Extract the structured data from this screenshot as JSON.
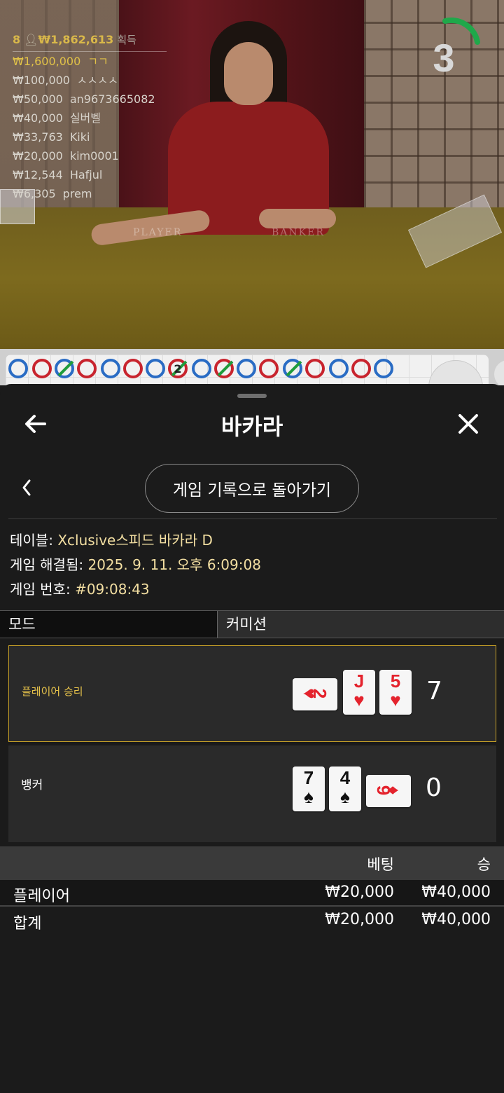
{
  "video": {
    "felt_labels": {
      "player": "PLAYER",
      "banker": "BANKER"
    },
    "countdown": "3",
    "winners": {
      "header_count": "8",
      "header_total": "₩1,862,613",
      "header_suffix": "획득",
      "rows": [
        {
          "amount": "₩1,600,000",
          "name": "ㄱㄱ"
        },
        {
          "amount": "₩100,000",
          "name": "ㅅㅅㅅㅅ"
        },
        {
          "amount": "₩50,000",
          "name": "an9673665082"
        },
        {
          "amount": "₩40,000",
          "name": "실버벨"
        },
        {
          "amount": "₩33,763",
          "name": "Kiki"
        },
        {
          "amount": "₩20,000",
          "name": "kim0001"
        },
        {
          "amount": "₩12,544",
          "name": "Hafjul"
        },
        {
          "amount": "₩6,305",
          "name": "prem"
        }
      ]
    },
    "road_marker_number": "2"
  },
  "panel": {
    "title": "바카라",
    "back_to_history": "게임 기록으로 돌아가기",
    "info": {
      "table_label": "테이블:",
      "table_value": "Xclusive스피드 바카라 D",
      "resolved_label": "게임 해결됨:",
      "resolved_value": "2025. 9. 11. 오후 6:09:08",
      "number_label": "게임 번호:",
      "number_value": "#09:08:43"
    },
    "tabs": [
      "모드",
      "커미션"
    ],
    "player_hand": {
      "label": "플레이어 승리",
      "score": "7",
      "cards": [
        {
          "rank": "2",
          "suit": "♥"
        },
        {
          "rank": "J",
          "suit": "♥"
        },
        {
          "rank": "5",
          "suit": "♥"
        }
      ]
    },
    "banker_hand": {
      "label": "뱅커",
      "score": "0",
      "cards": [
        {
          "rank": "7",
          "suit": "♠"
        },
        {
          "rank": "4",
          "suit": "♠"
        },
        {
          "rank": "9",
          "suit": "♦"
        }
      ]
    },
    "bets": {
      "col_bet": "베팅",
      "col_win": "승",
      "rows": [
        {
          "name": "플레이어",
          "bet": "₩20,000",
          "win": "₩40,000"
        },
        {
          "name": "합계",
          "bet": "₩20,000",
          "win": "₩40,000"
        }
      ]
    }
  },
  "colors": {
    "accent_gold": "#c9a227",
    "value_text": "#f3dfa2",
    "card_red": "#e4232d",
    "road_blue": "#2a6cc4",
    "road_red": "#c8242e",
    "timer_green": "#1fa84a"
  }
}
